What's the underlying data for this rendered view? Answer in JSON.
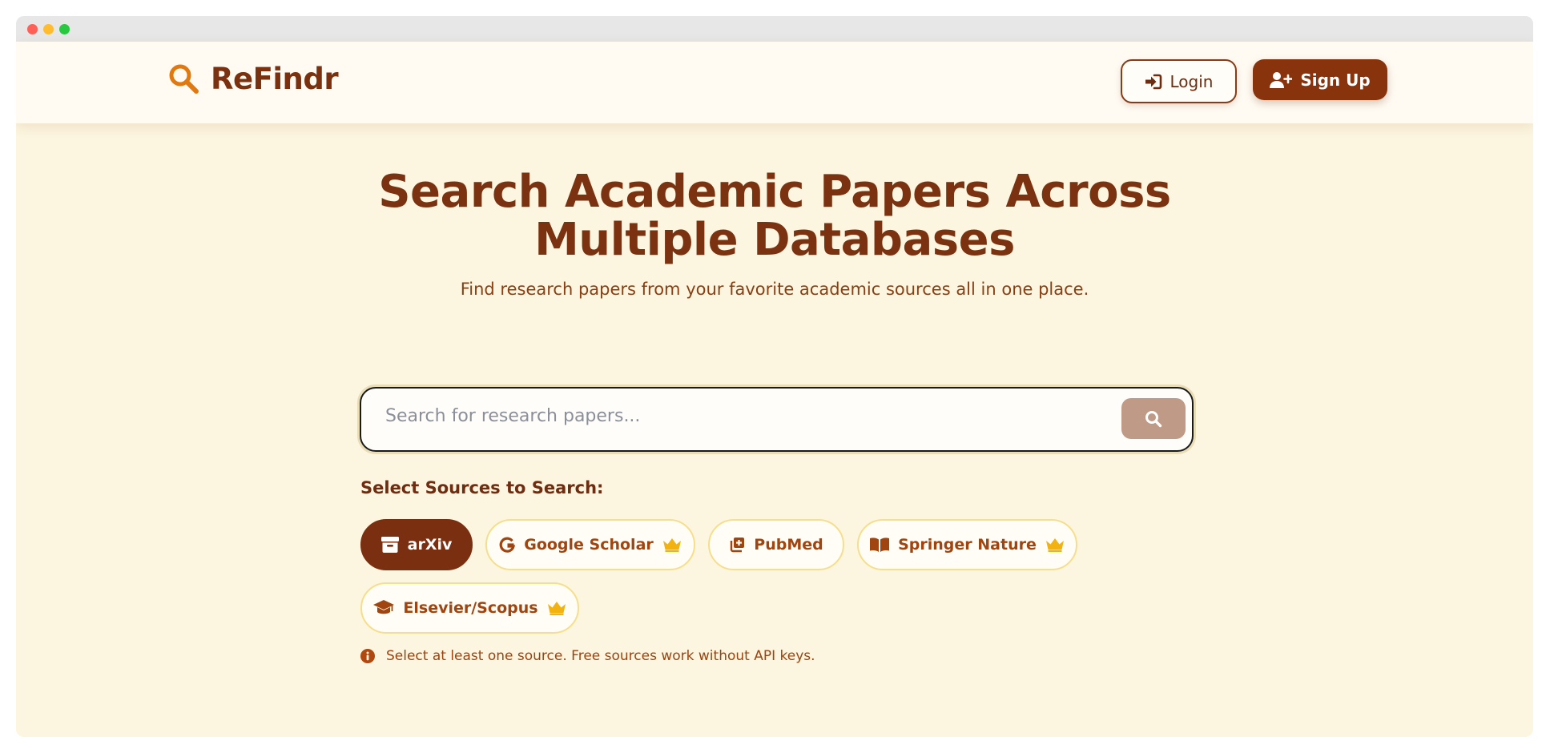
{
  "brand": {
    "name": "ReFindr"
  },
  "nav": {
    "login_label": "Login",
    "signup_label": "Sign Up"
  },
  "hero": {
    "title_line1": "Search Academic Papers Across",
    "title_line2": "Multiple Databases",
    "subtitle": "Find research papers from your favorite academic sources all in one place."
  },
  "search": {
    "placeholder": "Search for research papers...",
    "value": ""
  },
  "sources": {
    "label": "Select Sources to Search:",
    "items": [
      {
        "label": "arXiv",
        "icon": "archive-icon",
        "selected": true,
        "premium": false
      },
      {
        "label": "Google Scholar",
        "icon": "google-icon",
        "selected": false,
        "premium": true
      },
      {
        "label": "PubMed",
        "icon": "pubmed-icon",
        "selected": false,
        "premium": false
      },
      {
        "label": "Springer Nature",
        "icon": "book-icon",
        "selected": false,
        "premium": true
      },
      {
        "label": "Elsevier/Scopus",
        "icon": "graduation-cap-icon",
        "selected": false,
        "premium": true
      }
    ],
    "note": "Select at least one source. Free sources work without API keys."
  },
  "colors": {
    "accent": "#88330C",
    "brand_icon": "#E07A10",
    "background": "#FCF5DF",
    "crown": "#F2B20F"
  }
}
